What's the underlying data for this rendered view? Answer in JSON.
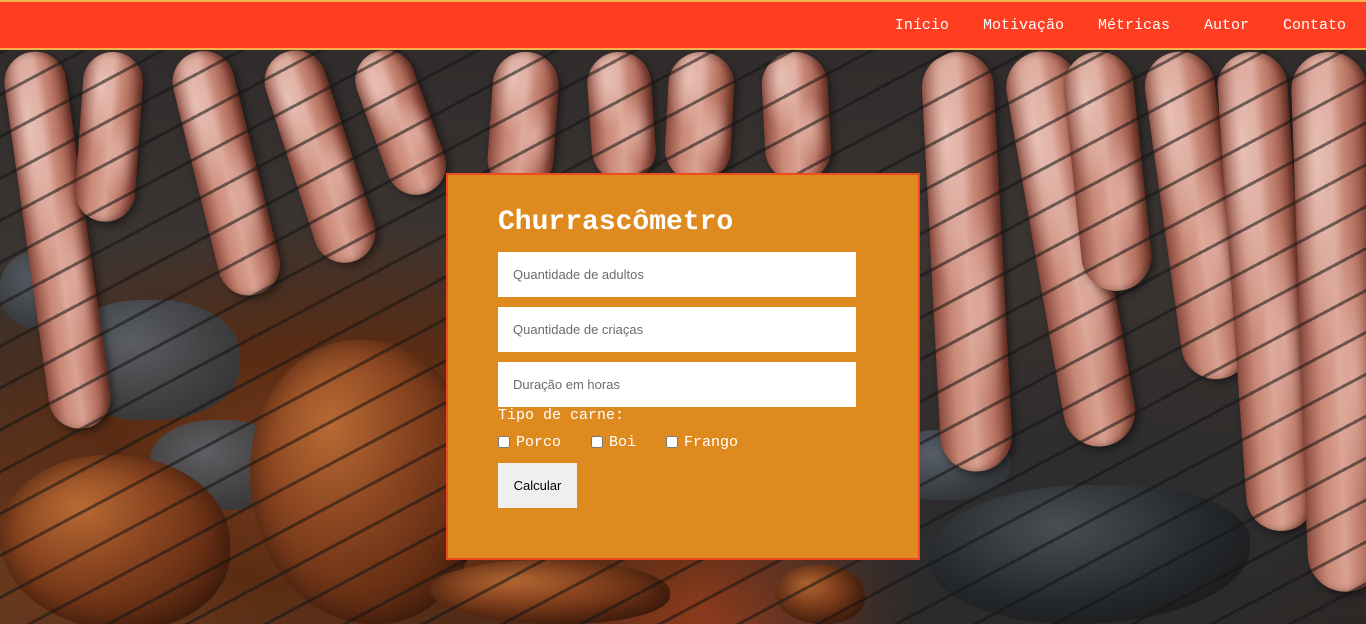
{
  "navbar": {
    "links": [
      "Início",
      "Motivação",
      "Métricas",
      "Autor",
      "Contato"
    ]
  },
  "form": {
    "title": "Churrascômetro",
    "adults_placeholder": "Quantidade de adultos",
    "children_placeholder": "Quantidade de criaças",
    "hours_placeholder": "Duração em horas",
    "meat_label": "Tipo de carne:",
    "meat_options": [
      "Porco",
      "Boi",
      "Frango"
    ],
    "submit_label": "Calcular"
  },
  "colors": {
    "navbar": "#ff3d21",
    "navbar_border": "#f6b24a",
    "card": "#df8a1e",
    "card_border": "#ee4a1f"
  }
}
